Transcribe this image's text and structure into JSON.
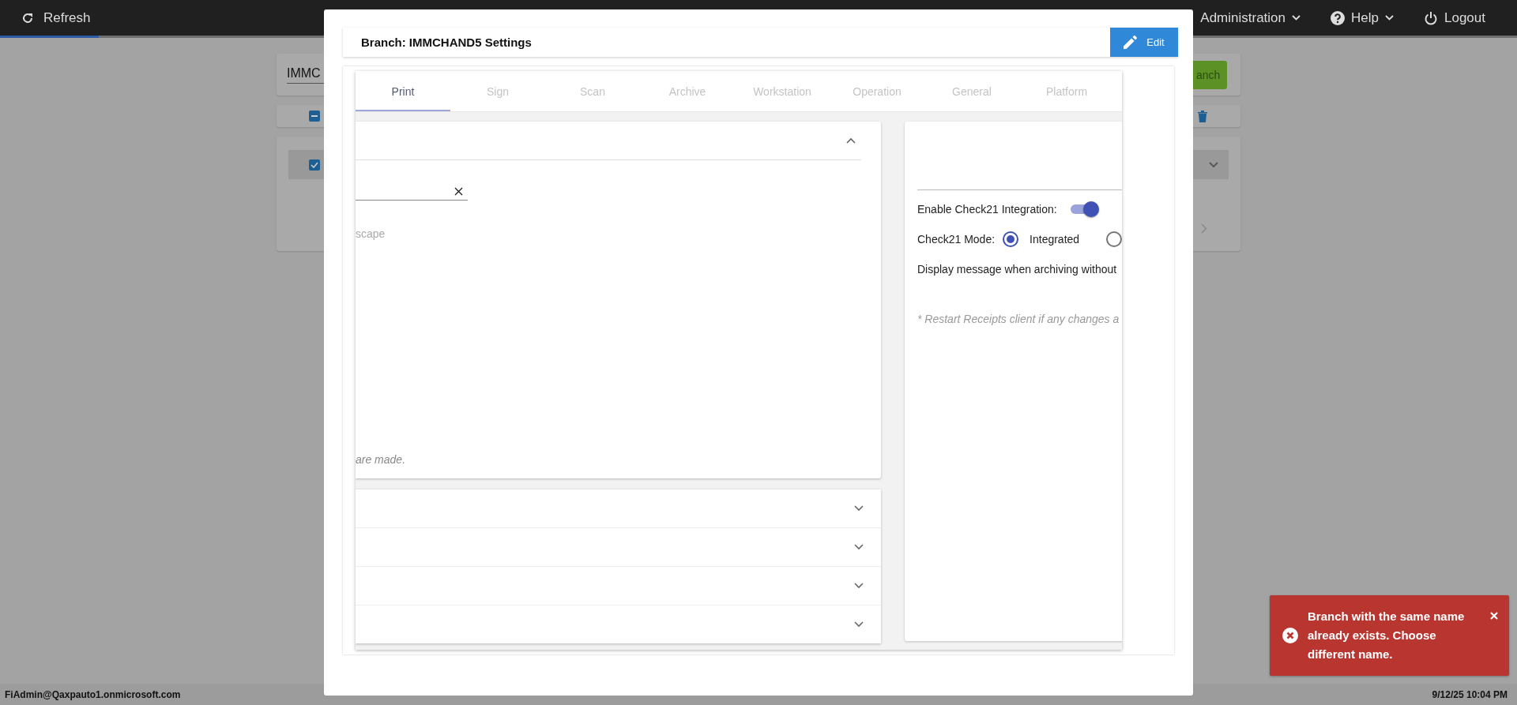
{
  "top_bar": {
    "refresh": "Refresh",
    "progress": {
      "level": 0.065
    },
    "menus": [
      {
        "label": "Administration",
        "kind": "dropdown"
      },
      {
        "label": "Help",
        "kind": "help"
      },
      {
        "label": "Logout",
        "kind": "logout"
      }
    ]
  },
  "background": {
    "search_value": "IMMC",
    "add_button": "anch",
    "select_all_indeterminate": true,
    "row_checked": true
  },
  "modal": {
    "title": "Branch: IMMCHAND5 Settings",
    "edit_button": "Edit",
    "tabs": [
      {
        "label": "Print",
        "selected": true
      },
      {
        "label": "Sign",
        "selected": false
      },
      {
        "label": "Scan",
        "selected": false
      },
      {
        "label": "Archive",
        "selected": false
      },
      {
        "label": "Workstation",
        "selected": false
      },
      {
        "label": "Operation",
        "selected": false
      },
      {
        "label": "General",
        "selected": false
      },
      {
        "label": "Platform",
        "selected": false
      }
    ],
    "print_panel": {
      "expanded": true,
      "option_text": "scape",
      "note": "are made."
    },
    "sections": [
      {
        "expanded": false
      },
      {
        "expanded": false
      },
      {
        "expanded": false
      },
      {
        "expanded": false
      }
    ],
    "check21": {
      "enable_label": "Enable Check21 Integration:",
      "enabled": true,
      "mode_label": "Check21 Mode:",
      "modes": [
        {
          "label": "Integrated",
          "selected": true
        },
        {
          "selected": false
        }
      ],
      "message_label": "Display message when archiving without",
      "note": "* Restart Receipts client if any changes a"
    }
  },
  "toast": {
    "message": "Branch with the same name already exists. Choose different name."
  },
  "status_bar": {
    "user": "FiAdmin@Qaxpauto1.onmicrosoft.com",
    "datetime": "9/12/25 10:04 PM"
  }
}
